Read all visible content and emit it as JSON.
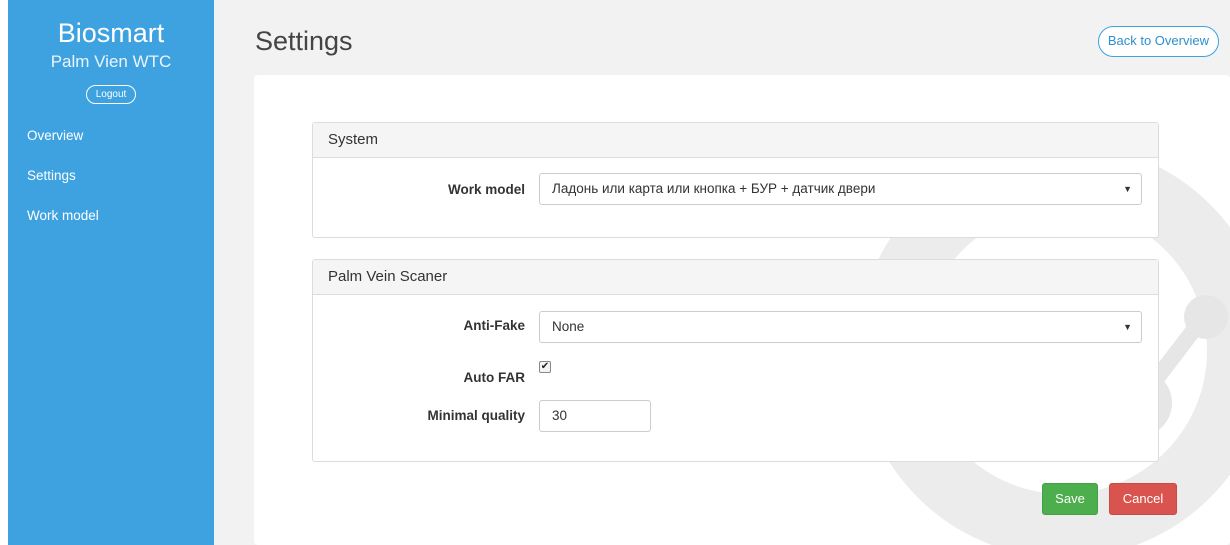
{
  "sidebar": {
    "brand_title": "Biosmart",
    "brand_subtitle": "Palm Vien WTC",
    "logout_label": "Logout",
    "nav": [
      {
        "label": "Overview"
      },
      {
        "label": "Settings"
      },
      {
        "label": "Work model"
      }
    ]
  },
  "header": {
    "title": "Settings",
    "back_label": "Back to Overview"
  },
  "system_panel": {
    "title": "System",
    "work_model_label": "Work model",
    "work_model_value": "Ладонь или карта или кнопка + БУР + датчик двери"
  },
  "scanner_panel": {
    "title": "Palm Vein Scaner",
    "anti_fake_label": "Anti-Fake",
    "anti_fake_value": "None",
    "auto_far_label": "Auto FAR",
    "auto_far_checked": true,
    "min_quality_label": "Minimal quality",
    "min_quality_value": "30"
  },
  "actions": {
    "save_label": "Save",
    "cancel_label": "Cancel"
  },
  "icons": {
    "select_caret": "caret-down-icon",
    "checkbox_mark": "checkmark-icon",
    "watermark": "biosmart-logo-watermark"
  },
  "colors": {
    "sidebar": "#3ea2e1",
    "save": "#4cae4c",
    "cancel": "#d9534f",
    "background": "#f2f2f2"
  }
}
